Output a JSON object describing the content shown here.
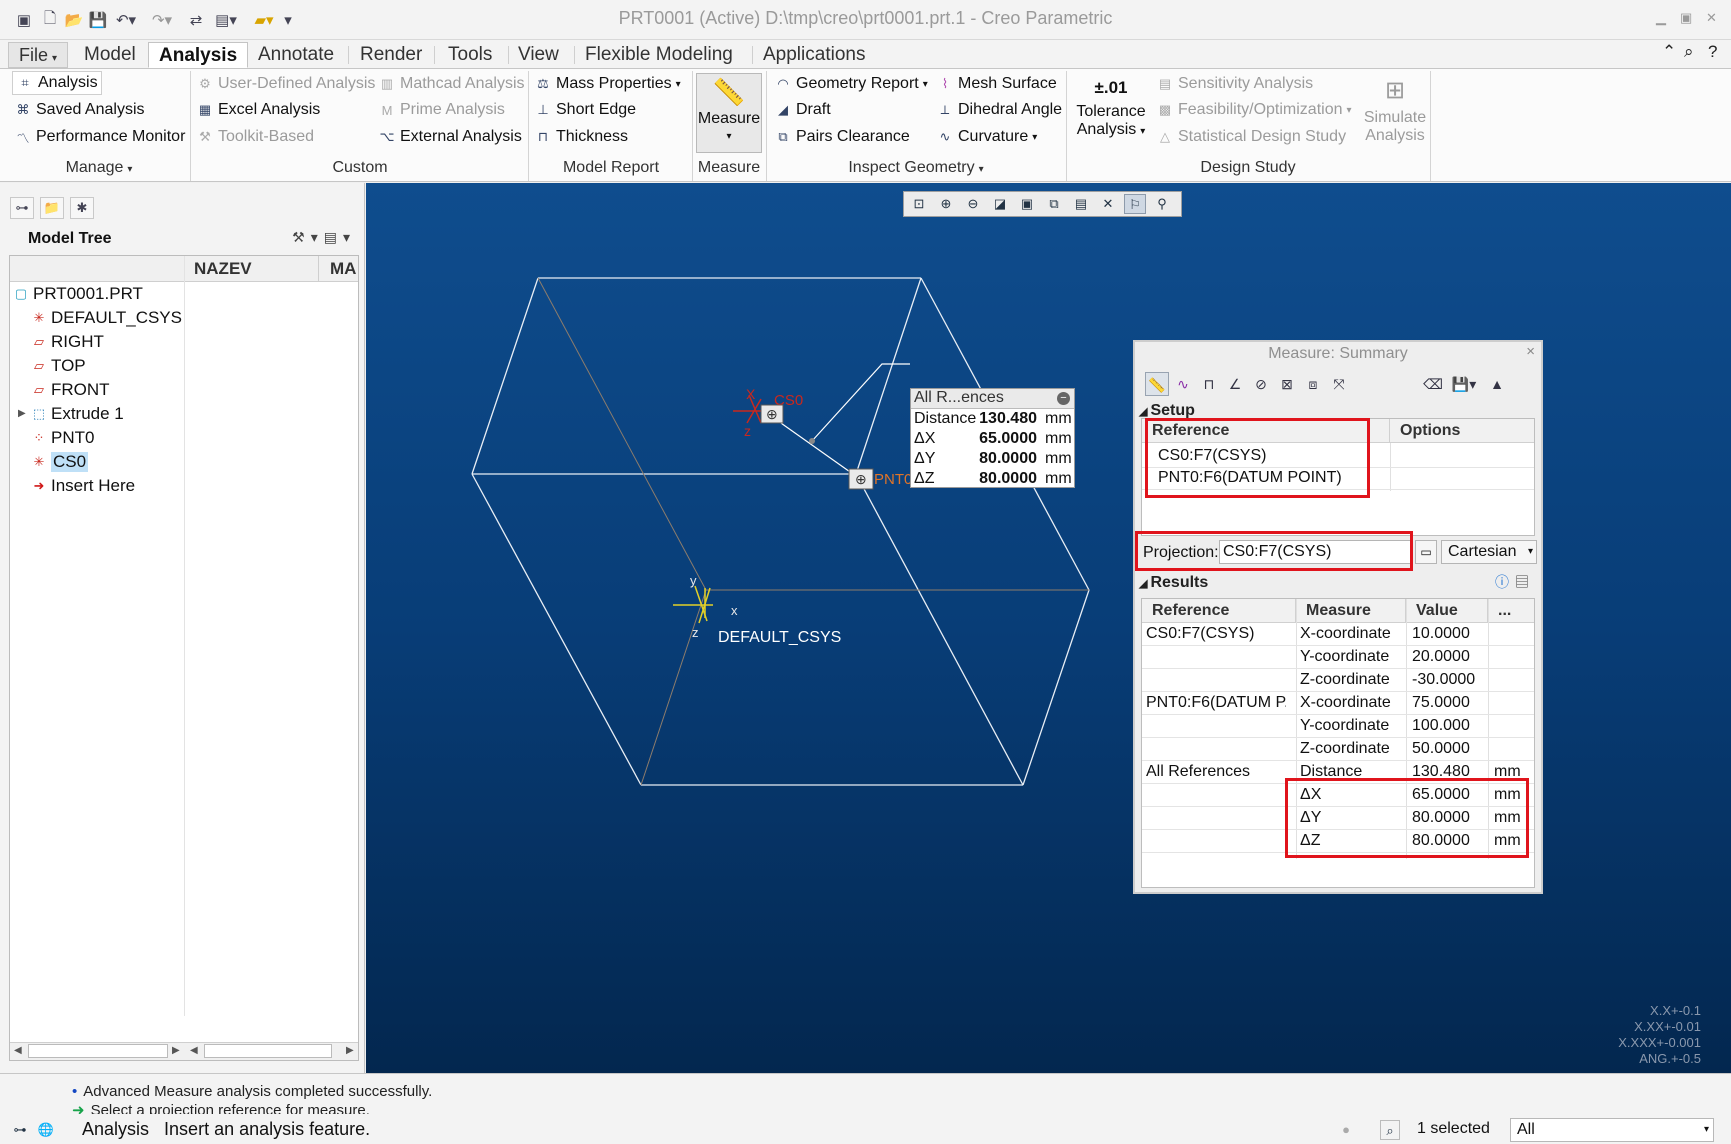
{
  "window": {
    "title": "PRT0001 (Active) D:\\tmp\\creo\\prt0001.prt.1 - Creo Parametric"
  },
  "menu": {
    "tabs": [
      "File",
      "Model",
      "Analysis",
      "Annotate",
      "Render",
      "Tools",
      "View",
      "Flexible Modeling",
      "Applications"
    ],
    "active": "Analysis"
  },
  "ribbon": {
    "manage": {
      "items": [
        "Analysis",
        "Saved Analysis",
        "Performance Monitor"
      ],
      "label": "Manage"
    },
    "custom": {
      "items": [
        "User-Defined Analysis",
        "Excel Analysis",
        "Toolkit-Based",
        "Mathcad Analysis",
        "Prime Analysis",
        "External Analysis"
      ],
      "label": "Custom"
    },
    "model_report": {
      "items": [
        "Mass Properties",
        "Short Edge",
        "Thickness"
      ],
      "label": "Model Report"
    },
    "measure": {
      "button": "Measure",
      "label": "Measure"
    },
    "inspect": {
      "items": [
        "Geometry Report",
        "Draft",
        "Pairs Clearance",
        "Mesh Surface",
        "Dihedral Angle",
        "Curvature"
      ],
      "label": "Inspect Geometry"
    },
    "design_study": {
      "tolerance_icon": "±.01",
      "tolerance_line1": "Tolerance",
      "tolerance_line2": "Analysis",
      "items": [
        "Sensitivity Analysis",
        "Feasibility/Optimization",
        "Statistical Design Study"
      ],
      "simulate_line1": "Simulate",
      "simulate_line2": "Analysis",
      "label": "Design Study"
    }
  },
  "model_tree": {
    "title": "Model Tree",
    "columns": [
      "NAZEV",
      "MA"
    ],
    "items": [
      {
        "label": "PRT0001.PRT",
        "icon": "part-icon"
      },
      {
        "label": "DEFAULT_CSYS",
        "icon": "csys-icon"
      },
      {
        "label": "RIGHT",
        "icon": "datum-plane-icon"
      },
      {
        "label": "TOP",
        "icon": "datum-plane-icon"
      },
      {
        "label": "FRONT",
        "icon": "datum-plane-icon"
      },
      {
        "label": "Extrude 1",
        "icon": "extrude-icon"
      },
      {
        "label": "PNT0",
        "icon": "datum-point-icon"
      },
      {
        "label": "CS0",
        "icon": "csys-icon"
      },
      {
        "label": "Insert Here",
        "icon": "insert-arrow-icon"
      }
    ],
    "selected": "CS0"
  },
  "viewport": {
    "labels": {
      "cs0": "CS0",
      "pnt0": "PNT0",
      "default_csys": "DEFAULT_CSYS",
      "axis_x": "X",
      "axis_y": "y",
      "axis_z": "z",
      "axis_x_lower": "x",
      "cs0_z": "z"
    },
    "callout": {
      "header": "All R...ences",
      "rows": [
        {
          "key": "Distance",
          "value": "130.480",
          "unit": "mm"
        },
        {
          "key": "ΔX",
          "value": "65.0000",
          "unit": "mm"
        },
        {
          "key": "ΔY",
          "value": "80.0000",
          "unit": "mm"
        },
        {
          "key": "ΔZ",
          "value": "80.0000",
          "unit": "mm"
        }
      ]
    },
    "tolerances": [
      "X.X+-0.1",
      "X.XX+-0.01",
      "X.XXX+-0.001",
      "ANG.+-0.5"
    ]
  },
  "measure_dialog": {
    "title": "Measure: Summary",
    "setup": {
      "heading": "Setup",
      "columns": [
        "Reference",
        "Options"
      ],
      "references": [
        "CS0:F7(CSYS)",
        "PNT0:F6(DATUM POINT)"
      ]
    },
    "projection": {
      "label": "Projection:",
      "value": "CS0:F7(CSYS)",
      "mode": "Cartesian"
    },
    "results": {
      "heading": "Results",
      "columns": [
        "Reference",
        "Measure",
        "Value",
        "..."
      ],
      "rows": [
        {
          "ref": "CS0:F7(CSYS)",
          "measure": "X-coordinate",
          "value": "10.0000",
          "unit": ""
        },
        {
          "ref": "",
          "measure": "Y-coordinate",
          "value": "20.0000",
          "unit": ""
        },
        {
          "ref": "",
          "measure": "Z-coordinate",
          "value": "-30.0000",
          "unit": ""
        },
        {
          "ref": "PNT0:F6(DATUM P...",
          "measure": "X-coordinate",
          "value": "75.0000",
          "unit": ""
        },
        {
          "ref": "",
          "measure": "Y-coordinate",
          "value": "100.000",
          "unit": ""
        },
        {
          "ref": "",
          "measure": "Z-coordinate",
          "value": "50.0000",
          "unit": ""
        },
        {
          "ref": "All References",
          "measure": "Distance",
          "value": "130.480",
          "unit": "mm"
        },
        {
          "ref": "",
          "measure": "ΔX",
          "value": "65.0000",
          "unit": "mm"
        },
        {
          "ref": "",
          "measure": "ΔY",
          "value": "80.0000",
          "unit": "mm"
        },
        {
          "ref": "",
          "measure": "ΔZ",
          "value": "80.0000",
          "unit": "mm"
        }
      ]
    }
  },
  "status": {
    "messages": [
      "Advanced Measure analysis completed successfully.",
      "Select a projection reference for measure."
    ],
    "mode": "Analysis",
    "hint": "Insert an analysis feature.",
    "selected": "1 selected",
    "filter": "All"
  },
  "colors": {
    "accent_red": "#e0141c",
    "viewport_top": "#0f4d8e",
    "viewport_bottom": "#03274f",
    "selection": "#bfe0f7",
    "csys_red": "#c8281e",
    "csys_yellow": "#e3d027"
  }
}
